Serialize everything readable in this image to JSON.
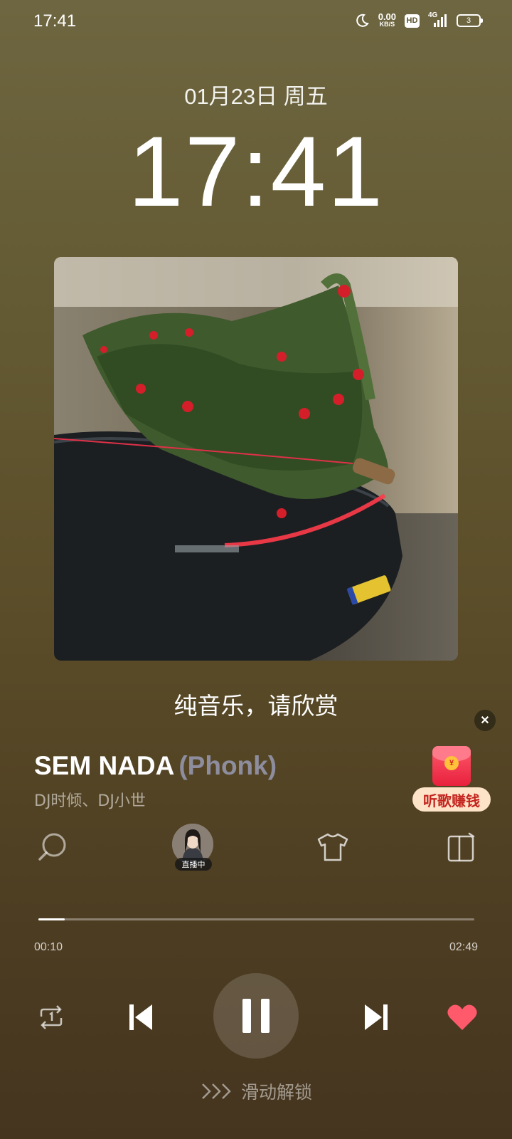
{
  "status_bar": {
    "time": "17:41",
    "net_speed": "0.00",
    "net_unit": "KB/S",
    "hd": "HD",
    "network": "4G",
    "battery": "3",
    "icons": [
      "moon-icon",
      "hd-icon",
      "signal-icon",
      "battery-icon"
    ]
  },
  "lockscreen": {
    "date": "01月23日 周五",
    "time": "17:41"
  },
  "player": {
    "lyric": "纯音乐，请欣赏",
    "title": "SEM NADA",
    "tag": "(Phonk)",
    "artist": "DJ时倾、DJ小世",
    "promo_label": "听歌赚钱",
    "promo_coin": "¥",
    "live_badge": "直播中",
    "elapsed": "00:10",
    "duration": "02:49",
    "progress": 0.06,
    "liked": true,
    "like_color": "#ff5a6c",
    "close_symbol": "✕",
    "unlock_hint": "滑动解锁",
    "tools": [
      "search-icon",
      "live-avatar",
      "tshirt-icon",
      "cast-icon"
    ],
    "controls": [
      "repeat-one-icon",
      "previous-icon",
      "pause-icon",
      "next-icon",
      "heart-icon"
    ]
  }
}
